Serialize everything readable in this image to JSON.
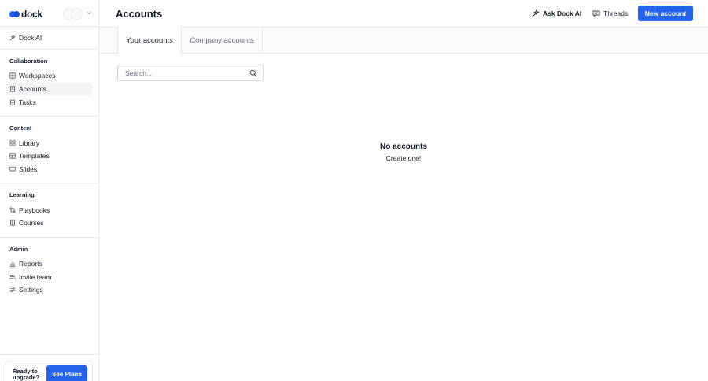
{
  "brand": {
    "name": "dock",
    "color": "#2563eb"
  },
  "sidebar": {
    "dock_ai": {
      "label": "Dock AI",
      "icon": "sparkle-icon"
    },
    "sections": [
      {
        "title": "Collaboration",
        "items": [
          {
            "label": "Workspaces",
            "icon": "workspaces-icon"
          },
          {
            "label": "Accounts",
            "icon": "accounts-icon",
            "active": true
          },
          {
            "label": "Tasks",
            "icon": "tasks-icon"
          }
        ]
      },
      {
        "title": "Content",
        "items": [
          {
            "label": "Library",
            "icon": "library-icon"
          },
          {
            "label": "Templates",
            "icon": "templates-icon"
          },
          {
            "label": "Slides",
            "icon": "slides-icon"
          }
        ]
      },
      {
        "title": "Learning",
        "items": [
          {
            "label": "Playbooks",
            "icon": "playbooks-icon"
          },
          {
            "label": "Courses",
            "icon": "courses-icon"
          }
        ]
      },
      {
        "title": "Admin",
        "items": [
          {
            "label": "Reports",
            "icon": "reports-icon"
          },
          {
            "label": "Invite team",
            "icon": "invite-icon"
          },
          {
            "label": "Settings",
            "icon": "settings-icon"
          }
        ]
      }
    ],
    "upgrade": {
      "text": "Ready to upgrade?",
      "button": "See Plans"
    }
  },
  "header": {
    "title": "Accounts",
    "ask_label": "Ask Dock AI",
    "threads_label": "Threads",
    "new_label": "New account",
    "accent": "#2563eb"
  },
  "tabs": [
    {
      "label": "Your accounts",
      "active": true
    },
    {
      "label": "Company accounts",
      "active": false
    }
  ],
  "search": {
    "placeholder": "Search...",
    "value": ""
  },
  "empty_state": {
    "title": "No accounts",
    "subtitle": "Create one!"
  }
}
